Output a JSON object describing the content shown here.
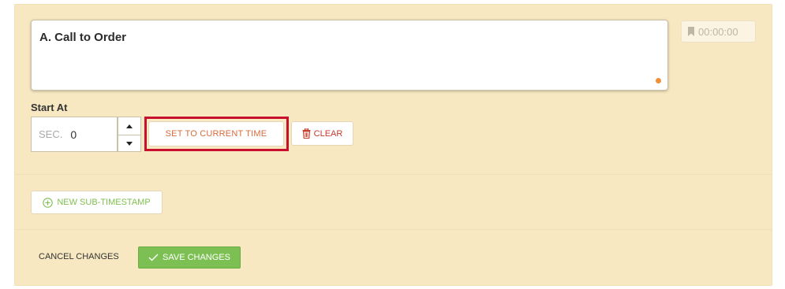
{
  "item": {
    "title": "A. Call to Order"
  },
  "timestamp_chip": {
    "time": "00:00:00",
    "icon": "bookmark-icon"
  },
  "start_at": {
    "label": "Start At",
    "unit": "SEC.",
    "value": "0"
  },
  "buttons": {
    "set_current_time": "SET TO CURRENT TIME",
    "clear": "CLEAR",
    "new_sub_timestamp": "NEW SUB-TIMESTAMP",
    "cancel_changes": "CANCEL CHANGES",
    "save_changes": "SAVE CHANGES"
  },
  "colors": {
    "panel_bg": "#f7e8c1",
    "highlight": "#c8102e",
    "set_time_text": "#d86b3c",
    "clear_text": "#c23a2a",
    "sub_timestamp_text": "#7fbf4d",
    "save_bg": "#7cc053",
    "status_dot": "#f0913a"
  }
}
